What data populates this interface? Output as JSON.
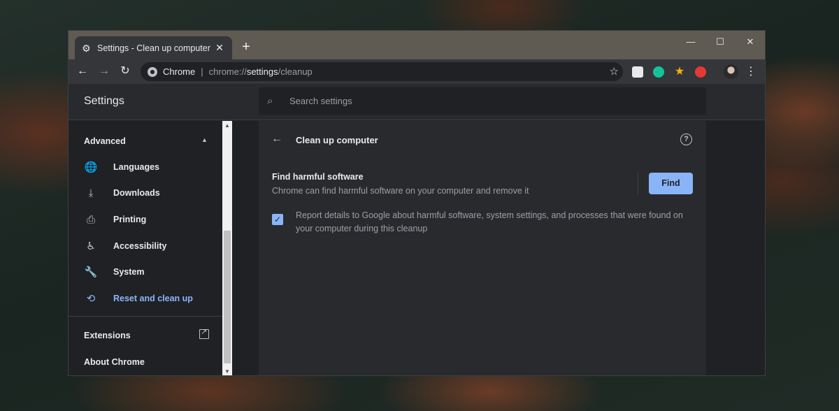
{
  "tab": {
    "title": "Settings - Clean up computer",
    "icon": "gear-icon",
    "close": "✕"
  },
  "new_tab": "+",
  "window_controls": {
    "minimize": "—",
    "maximize": "☐",
    "close": "✕"
  },
  "toolbar": {
    "back": "←",
    "forward": "→",
    "reload": "↻",
    "menu": "⋮"
  },
  "omnibox": {
    "site": "Chrome",
    "separator": "|",
    "url_prefix": "chrome://",
    "url_host": "settings",
    "url_path": "/cleanup",
    "star": "☆"
  },
  "extensions": [
    {
      "name": "note-extension-icon",
      "color": "#e8eaed"
    },
    {
      "name": "grammarly-extension-icon",
      "color": "#15c39a"
    },
    {
      "name": "star-extension-icon",
      "color": "#f4b400"
    },
    {
      "name": "record-extension-icon",
      "color": "#e53935"
    }
  ],
  "settings_header": {
    "title": "Settings",
    "search_placeholder": "Search settings",
    "search_icon": "⌕"
  },
  "sidebar": {
    "section": "Advanced",
    "caret": "▲",
    "items": [
      {
        "label": "Languages",
        "icon": "🌐",
        "icon_name": "globe-icon",
        "active": false
      },
      {
        "label": "Downloads",
        "icon": "⤓",
        "icon_name": "download-icon",
        "active": false
      },
      {
        "label": "Printing",
        "icon": "⎙",
        "icon_name": "printer-icon",
        "active": false
      },
      {
        "label": "Accessibility",
        "icon": "♿",
        "icon_name": "accessibility-icon",
        "active": false
      },
      {
        "label": "System",
        "icon": "🔧",
        "icon_name": "wrench-icon",
        "active": false
      },
      {
        "label": "Reset and clean up",
        "icon": "⟲",
        "icon_name": "restore-icon",
        "active": true
      }
    ],
    "extensions": "Extensions",
    "about": "About Chrome"
  },
  "scrollbar": {
    "up": "▲",
    "down": "▼"
  },
  "main": {
    "back": "←",
    "title": "Clean up computer",
    "help": "?",
    "find_title": "Find harmful software",
    "find_desc": "Chrome can find harmful software on your computer and remove it",
    "find_button": "Find",
    "checkbox_checked": true,
    "checkbox_mark": "✓",
    "checkbox_label": "Report details to Google about harmful software, system settings, and processes that were found on your computer during this cleanup"
  },
  "colors": {
    "accent": "#8ab4f8",
    "background": "#202124",
    "surface": "#292a2d",
    "titlebar": "#5f5a52"
  }
}
